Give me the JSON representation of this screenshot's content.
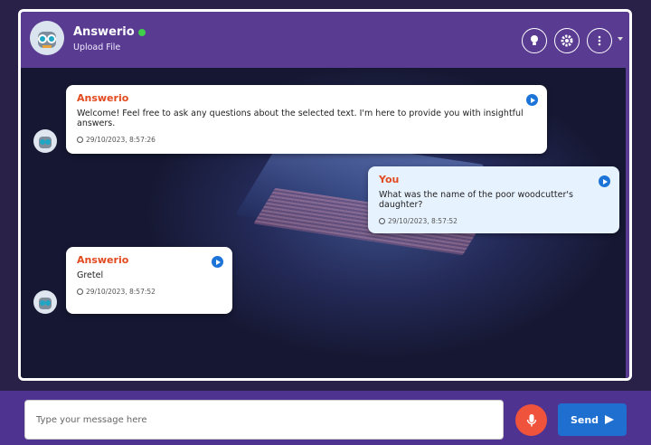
{
  "header": {
    "title": "Answerio",
    "subtitle": "Upload File",
    "status_color": "#3fcf4a",
    "icons": [
      "lightbulb-icon",
      "gear-icon",
      "more-vertical-icon",
      "chevron-down-icon"
    ]
  },
  "messages": [
    {
      "sender": "Answerio",
      "text": "Welcome! Feel free to ask any questions about the selected text. I'm here to provide you with insightful answers.",
      "timestamp": "29/10/2023, 8:57:26"
    },
    {
      "sender": "You",
      "text": "What was the name of the poor woodcutter's daughter?",
      "timestamp": "29/10/2023, 8:57:52"
    },
    {
      "sender": "Answerio",
      "text": "Gretel",
      "timestamp": "29/10/2023, 8:57:52"
    }
  ],
  "composer": {
    "placeholder": "Type your message here",
    "send_label": "Send"
  },
  "colors": {
    "accent": "#5a3b92",
    "sender": "#e24a20",
    "play": "#1c73d8",
    "mic": "#f0533c",
    "send": "#1e6fd0"
  }
}
